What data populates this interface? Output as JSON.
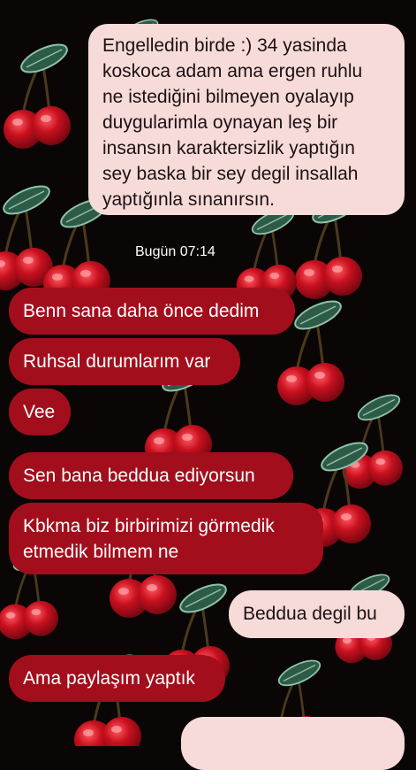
{
  "colors": {
    "background": "#0a0606",
    "sent_bubble": "#f7dbd9",
    "sent_text": "#1b1111",
    "received_bubble": "#a30e1c",
    "received_text": "#ffffff",
    "cherry": "#c8101e",
    "leaf": "#2e5a48"
  },
  "wallpaper": {
    "pattern": "cherry-icon"
  },
  "chat": {
    "date_divider": "Bugün 07:14",
    "messages": [
      {
        "direction": "sent",
        "text": "Engelledin birde :)  34 yasinda\nkoskoca adam ama ergen ruhlu\nne istediğini bilmeyen oyalayıp\nduygularimla oynayan leş bir\ninsansın  karaktersizlik yaptığın\nsey baska bir sey degil insallah\nyaptığınla sınanırsın."
      },
      {
        "direction": "received",
        "text": "Benn sana daha önce dedim"
      },
      {
        "direction": "received",
        "text": "Ruhsal durumlarım var"
      },
      {
        "direction": "received",
        "text": "Vee"
      },
      {
        "direction": "received",
        "text": "Sen bana beddua ediyorsun"
      },
      {
        "direction": "received",
        "text": "Kbkma biz birbirimizi görmedik\netmedik bilmem ne"
      },
      {
        "direction": "sent",
        "text": "Beddua degil bu"
      },
      {
        "direction": "received",
        "text": "Ama paylaşım yaptık"
      }
    ]
  }
}
